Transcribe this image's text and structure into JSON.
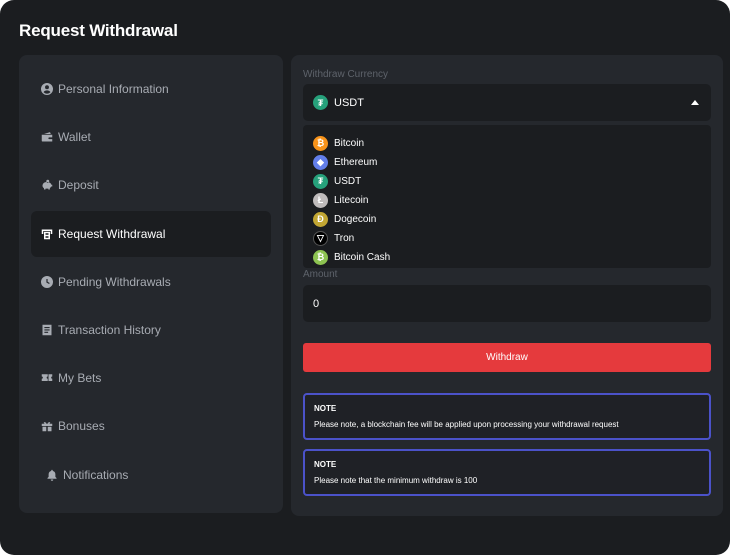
{
  "title": "Request Withdrawal",
  "sidebar": {
    "items": [
      {
        "label": "Personal Information",
        "icon": "user-circle-icon"
      },
      {
        "label": "Wallet",
        "icon": "wallet-icon"
      },
      {
        "label": "Deposit",
        "icon": "piggy-bank-icon"
      },
      {
        "label": "Request Withdrawal",
        "icon": "withdraw-icon",
        "active": true
      },
      {
        "label": "Pending Withdrawals",
        "icon": "clock-icon"
      },
      {
        "label": "Transaction History",
        "icon": "document-icon"
      },
      {
        "label": "My Bets",
        "icon": "tickets-icon"
      },
      {
        "label": "Bonuses",
        "icon": "gift-icon"
      },
      {
        "label": "Notifications",
        "icon": "bell-icon"
      }
    ]
  },
  "form": {
    "currency_label": "Withdraw Currency",
    "selected_currency": "USDT",
    "options": [
      "Bitcoin",
      "Ethereum",
      "USDT",
      "Litecoin",
      "Dogecoin",
      "Tron",
      "Bitcoin Cash"
    ],
    "amount_label": "Amount",
    "amount_value": "0",
    "withdraw_label": "Withdraw"
  },
  "notes": [
    {
      "title": "NOTE",
      "text": "Please note, a blockchain fee will be applied upon processing your withdrawal request"
    },
    {
      "title": "NOTE",
      "text": "Please note that the minimum withdraw is 100"
    }
  ],
  "colors": {
    "accent": "#e53a3d",
    "note_border": "#4b52c9",
    "bitcoin": "#f7931a",
    "ethereum": "#627eea",
    "usdt": "#26a17b",
    "litecoin": "#bfbbbb",
    "dogecoin": "#c2a633",
    "tron": "#000000",
    "bitcoin_cash": "#8dc351"
  }
}
